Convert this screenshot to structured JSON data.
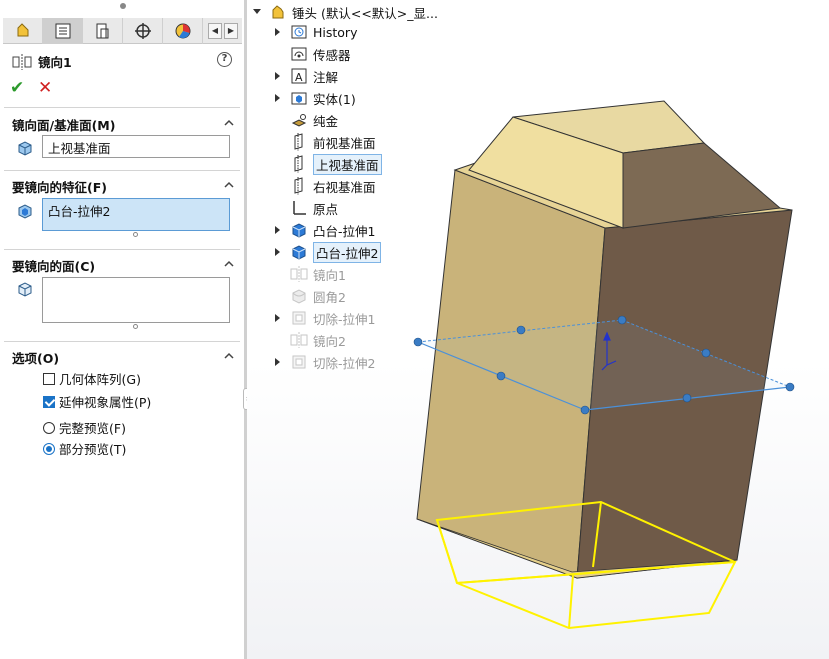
{
  "property_manager": {
    "tabs": [
      "feature-manager-icon",
      "property-manager-icon",
      "configuration-manager-icon",
      "dimxpert-icon",
      "display-manager-icon"
    ],
    "title": "镜向1",
    "help": "?",
    "ok": "✔",
    "cancel": "✕",
    "sections": {
      "mirror_face": {
        "title": "镜向面/基准面(M)",
        "value": "上视基准面"
      },
      "features": {
        "title": "要镜向的特征(F)",
        "value": "凸台-拉伸2"
      },
      "faces": {
        "title": "要镜向的面(C)",
        "value": ""
      },
      "options": {
        "title": "选项(O)",
        "geometry_pattern": {
          "label": "几何体阵列(G)",
          "checked": false
        },
        "propagate_visual": {
          "label": "延伸视象属性(P)",
          "checked": true
        },
        "full_preview": {
          "label": "完整预览(F)",
          "selected": false
        },
        "partial_preview": {
          "label": "部分预览(T)",
          "selected": true
        }
      }
    }
  },
  "tree": {
    "root": "锤头  (默认<<默认>_显...",
    "items": [
      {
        "label": "History",
        "icon": "history-icon",
        "expander": true
      },
      {
        "label": "传感器",
        "icon": "sensor-icon",
        "expander": false
      },
      {
        "label": "注解",
        "icon": "annotation-icon",
        "expander": true
      },
      {
        "label": "实体(1)",
        "icon": "solid-bodies-icon",
        "expander": true
      },
      {
        "label": "纯金",
        "icon": "material-icon",
        "expander": false
      },
      {
        "label": "前视基准面",
        "icon": "plane-icon",
        "expander": false
      },
      {
        "label": "上视基准面",
        "icon": "plane-icon",
        "expander": false,
        "selected": true
      },
      {
        "label": "右视基准面",
        "icon": "plane-icon",
        "expander": false
      },
      {
        "label": "原点",
        "icon": "origin-icon",
        "expander": false
      },
      {
        "label": "凸台-拉伸1",
        "icon": "extrude-icon",
        "expander": true
      },
      {
        "label": "凸台-拉伸2",
        "icon": "extrude-icon",
        "expander": true,
        "selected": true
      },
      {
        "label": "镜向1",
        "icon": "mirror-icon",
        "expander": false,
        "gray": true
      },
      {
        "label": "圆角2",
        "icon": "fillet-icon",
        "expander": false,
        "gray": true
      },
      {
        "label": "切除-拉伸1",
        "icon": "cut-extrude-icon",
        "expander": true,
        "gray": true
      },
      {
        "label": "镜向2",
        "icon": "mirror-icon",
        "expander": false,
        "gray": true
      },
      {
        "label": "切除-拉伸2",
        "icon": "cut-extrude-icon",
        "expander": true,
        "gray": true
      }
    ]
  },
  "colors": {
    "accent": "#1a73c7",
    "preview": "#ffee00",
    "plane": "#4a90d9",
    "body_light": "#c8b37a",
    "body_dark": "#6e5a47"
  }
}
